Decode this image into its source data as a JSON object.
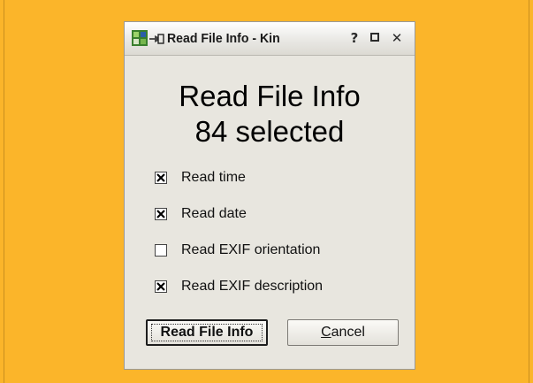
{
  "window": {
    "title": "Read File Info - Kin",
    "help_glyph": "?",
    "close_glyph": "✕",
    "app_icon": "kim-app-icon",
    "pin_icon": "pin-icon"
  },
  "heading": {
    "line1": "Read File Info",
    "line2": "84 selected"
  },
  "options": [
    {
      "label": "Read time",
      "checked": true
    },
    {
      "label": "Read date",
      "checked": true
    },
    {
      "label": "Read EXIF orientation",
      "checked": false
    },
    {
      "label": "Read EXIF description",
      "checked": true
    }
  ],
  "buttons": {
    "ok_label": "Read File Info",
    "cancel_label": "Cancel",
    "cancel_mnemonic": "C"
  },
  "colors": {
    "desktop": "#fbb52a",
    "window_bg": "#e8e6df"
  }
}
